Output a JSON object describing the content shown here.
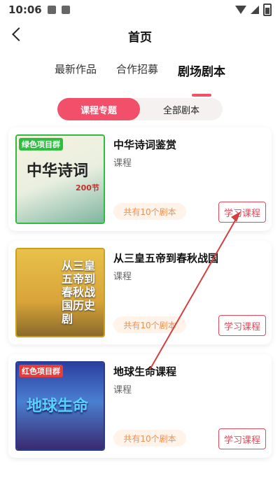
{
  "status_bar": {
    "time": "10:06"
  },
  "header": {
    "title": "首页"
  },
  "tabs": [
    {
      "label": "最新作品"
    },
    {
      "label": "合作招募"
    },
    {
      "label": "剧场剧本"
    }
  ],
  "segment": {
    "left": "课程专题",
    "right": "全部剧本"
  },
  "cards": [
    {
      "title": "中华诗词鉴赏",
      "subtitle": "课程",
      "count": "共有10个剧本",
      "button": "学习课程",
      "cover_badge": "绿色项目群",
      "cover_text": "中华诗词",
      "cover_extra": "200节"
    },
    {
      "title": "从三皇五帝到春秋战国",
      "subtitle": "课程",
      "count": "共有10个剧本",
      "button": "学习课程",
      "cover_text": "从三皇五帝到春秋战国历史剧"
    },
    {
      "title": "地球生命课程",
      "subtitle": "课程",
      "count": "共有10个剧本",
      "button": "学习课程",
      "cover_badge": "红色项目群",
      "cover_text": "地球生命"
    }
  ],
  "colors": {
    "accent": "#f2506a",
    "button": "#e34a5a",
    "pill_text": "#f09050"
  }
}
